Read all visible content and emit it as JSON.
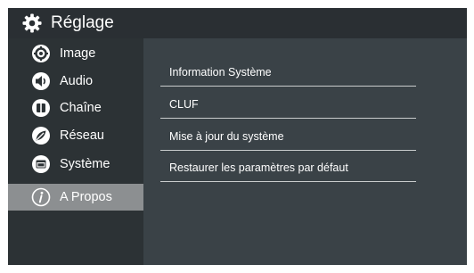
{
  "header": {
    "title": "Réglage",
    "icon": "gear-icon"
  },
  "sidebar": {
    "items": [
      {
        "label": "Image",
        "icon": "image-settings-icon",
        "selected": false
      },
      {
        "label": "Audio",
        "icon": "speaker-icon",
        "selected": false
      },
      {
        "label": "Chaîne",
        "icon": "channel-icon",
        "selected": false
      },
      {
        "label": "Réseau",
        "icon": "network-icon",
        "selected": false
      },
      {
        "label": "Système",
        "icon": "system-icon",
        "selected": false
      },
      {
        "label": "A Propos",
        "icon": "info-icon",
        "selected": true
      }
    ]
  },
  "main": {
    "items": [
      {
        "label": "Information Système"
      },
      {
        "label": "CLUF"
      },
      {
        "label": "Mise à jour du système"
      },
      {
        "label": "Restaurer les paramètres par défaut"
      }
    ]
  },
  "colors": {
    "background": "#3a4247",
    "header": "#2a2f33",
    "sidebar": "#2c3235",
    "selected": "#8c8f91",
    "text": "#ffffff",
    "divider": "#c9cccd"
  }
}
